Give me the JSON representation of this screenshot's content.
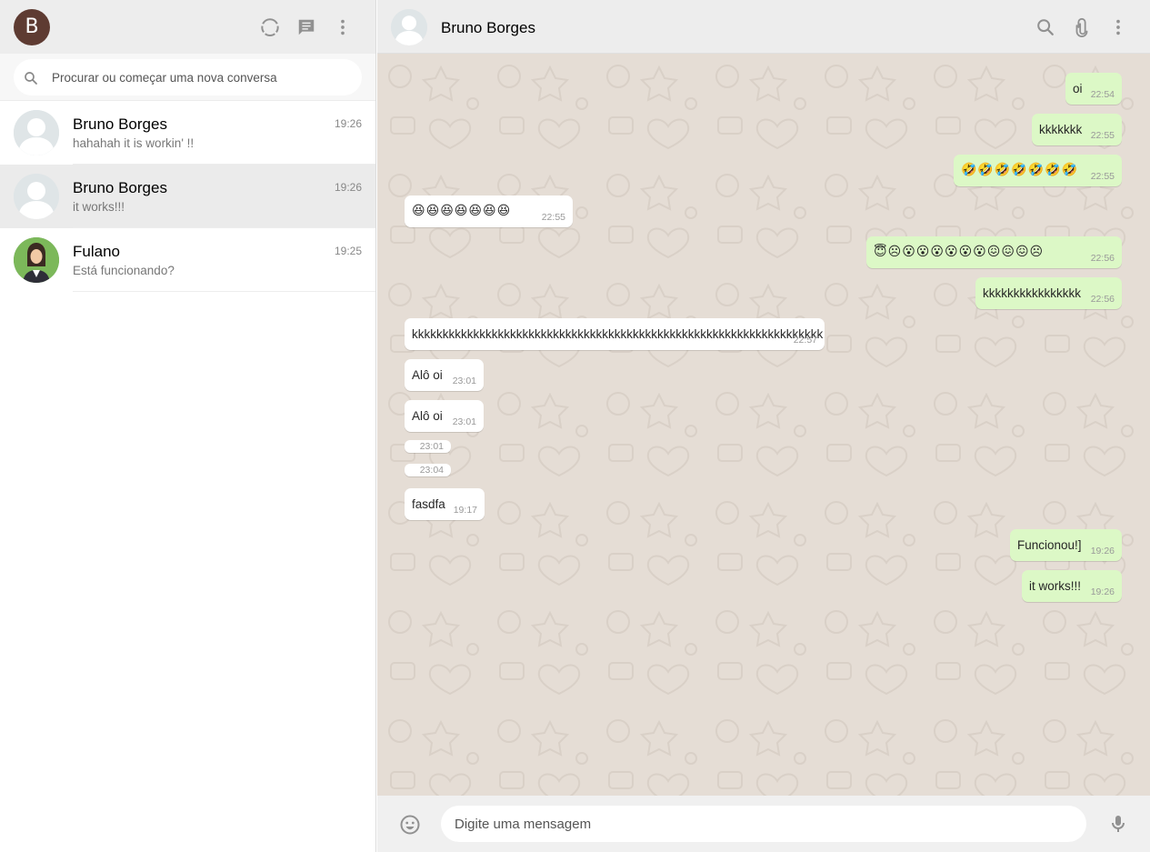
{
  "me": {
    "initial": "B",
    "avatar_color": "#5e3b32"
  },
  "icons": {
    "status": "status-ring-icon",
    "new_chat": "chat-bubble-icon",
    "menu": "kebab-menu-icon",
    "search": "search-icon",
    "attach": "paperclip-icon",
    "emoji": "smiley-icon",
    "mic": "microphone-icon"
  },
  "search": {
    "placeholder": "Procurar ou começar uma nova conversa"
  },
  "chats": [
    {
      "name": "Bruno Borges",
      "preview": "hahahah it is workin' !!",
      "time": "19:26",
      "active": false
    },
    {
      "name": "Bruno Borges",
      "preview": "it works!!!",
      "time": "19:26",
      "active": true
    },
    {
      "name": "Fulano",
      "preview": "Está funcionando?",
      "time": "19:25",
      "active": false
    }
  ],
  "conversation": {
    "name": "Bruno Borges",
    "messages": [
      {
        "dir": "out",
        "text": "oi",
        "time": "22:54"
      },
      {
        "dir": "out",
        "text": "kkkkkkk",
        "time": "22:55"
      },
      {
        "dir": "out",
        "text": "🤣🤣🤣🤣🤣🤣🤣",
        "time": "22:55"
      },
      {
        "dir": "in",
        "text": "😆😆😆😆😆😆😆",
        "time": "22:55"
      },
      {
        "dir": "out",
        "text": "😇☹😮😮😮😮😮😮😖😖😖☹",
        "time": "22:56"
      },
      {
        "dir": "out",
        "text": "kkkkkkkkkkkkkkkk",
        "time": "22:56"
      },
      {
        "dir": "in",
        "text": "kkkkkkkkkkkkkkkkkkkkkkkkkkkkkkkkkkkkkkkkkkkkkkkkkkkkkkkkkkkkkkkkkkk",
        "time": "22:57"
      },
      {
        "dir": "in",
        "text": "Alô oi",
        "time": "23:01"
      },
      {
        "dir": "in",
        "text": "Alô oi",
        "time": "23:01"
      },
      {
        "dir": "in",
        "text": "",
        "time": "23:01"
      },
      {
        "dir": "in",
        "text": "",
        "time": "23:04"
      },
      {
        "dir": "in",
        "text": "fasdfa",
        "time": "19:17"
      },
      {
        "dir": "out",
        "text": "Funcionou!]",
        "time": "19:26"
      },
      {
        "dir": "out",
        "text": "it works!!!",
        "time": "19:26"
      }
    ]
  },
  "composer": {
    "placeholder": "Digite uma mensagem"
  },
  "colors": {
    "outgoing": "#dcf8c6",
    "incoming": "#ffffff",
    "chat_bg": "#e5ddd5",
    "header": "#ededed"
  }
}
